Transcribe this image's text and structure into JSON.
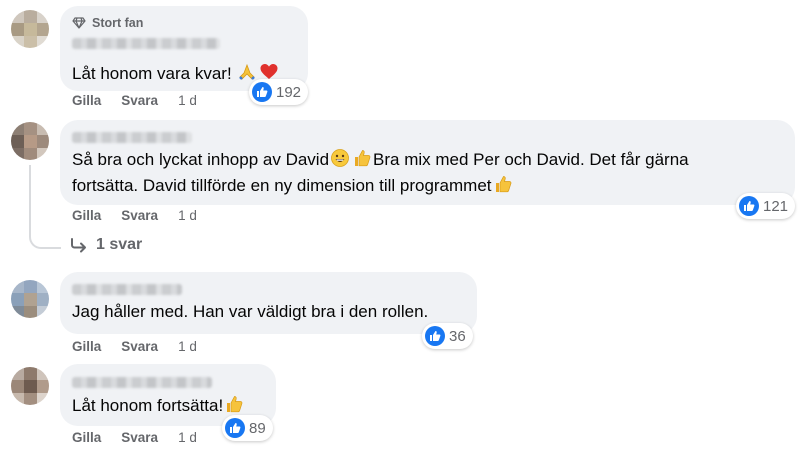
{
  "comments": [
    {
      "badge": "Stort fan",
      "text": "Låt honom vara kvar!",
      "emojis": [
        "pray",
        "heart"
      ],
      "likes": "192",
      "actions": {
        "like": "Gilla",
        "reply": "Svara",
        "age": "1 d"
      }
    },
    {
      "line1": "Så bra och lyckat inhopp av David",
      "line1b": "Bra mix med Per och David. Det får gärna",
      "line2": "fortsätta. David tillförde en ny dimension till programmet",
      "likes": "121",
      "actions": {
        "like": "Gilla",
        "reply": "Svara",
        "age": "1 d"
      },
      "replies": "1 svar"
    },
    {
      "text": "Jag håller med. Han var väldigt bra i den rollen.",
      "likes": "36",
      "actions": {
        "like": "Gilla",
        "reply": "Svara",
        "age": "1 d"
      }
    },
    {
      "text": "Låt honom fortsätta!",
      "likes": "89",
      "actions": {
        "like": "Gilla",
        "reply": "Svara",
        "age": "1 d"
      }
    }
  ],
  "colors": {
    "like_blue": "#1877f2",
    "bubble": "#f0f2f5",
    "meta": "#65676b"
  }
}
